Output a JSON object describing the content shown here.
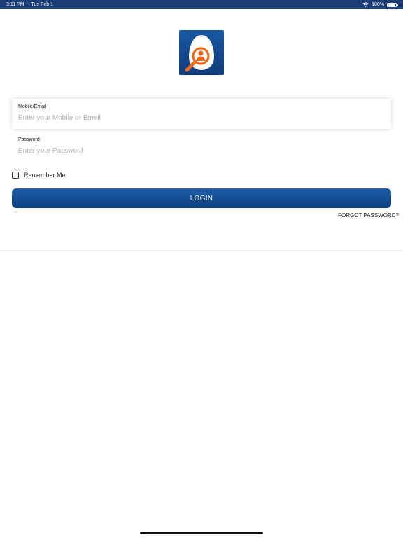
{
  "status_bar": {
    "time": "3:11 PM",
    "date": "Tue Feb 1",
    "battery": "100%",
    "battery_level": 1.0,
    "color": "#1b3e78"
  },
  "logo": {
    "icon": "person-search-icon",
    "colors": {
      "bg": "#1a4d94",
      "accent": "#f26b1d"
    }
  },
  "form": {
    "email": {
      "label": "Mobile/Email",
      "placeholder": "Enter your Mobile or Email",
      "value": ""
    },
    "password": {
      "label": "Password",
      "placeholder": "Enter your Password",
      "value": ""
    },
    "remember_me": {
      "label": "Remember Me",
      "checked": false
    },
    "login_label": "LOGIN",
    "forgot_label": "FORGOT PASSWORD?"
  }
}
